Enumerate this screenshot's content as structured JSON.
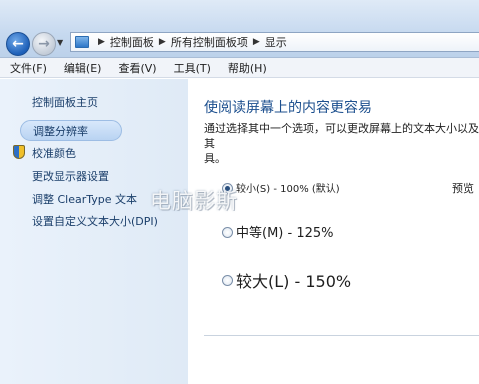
{
  "address_bar": {
    "crumbs": [
      "控制面板",
      "所有控制面板项",
      "显示"
    ]
  },
  "menu": {
    "items": [
      "文件(F)",
      "编辑(E)",
      "查看(V)",
      "工具(T)",
      "帮助(H)"
    ]
  },
  "sidebar": {
    "home": "控制面板主页",
    "items": [
      "调整分辨率",
      "校准颜色",
      "更改显示器设置",
      "调整 ClearType 文本",
      "设置自定义文本大小(DPI)"
    ],
    "selected_index": 0
  },
  "main": {
    "heading": "使阅读屏幕上的内容更容易",
    "description": "通过选择其中一个选项，可以更改屏幕上的文本大小以及其他项目。要暂时放大部分屏幕，请使用放大镜工具。",
    "description_visible": "通过选择其中一个选项，可以更改屏幕上的文本大小以及其他项目。",
    "options": [
      {
        "label": "较小(S) - 100% (默认)",
        "checked": true
      },
      {
        "label": "中等(M) - 125%",
        "checked": false
      },
      {
        "label": "较大(L) - 150%",
        "checked": false
      }
    ],
    "preview_label": "预览"
  },
  "watermark": "电脑影斯",
  "colors": {
    "heading": "#1c4f8e",
    "link": "#1a3e6a",
    "sidebar_bg": "#e4eef9"
  }
}
